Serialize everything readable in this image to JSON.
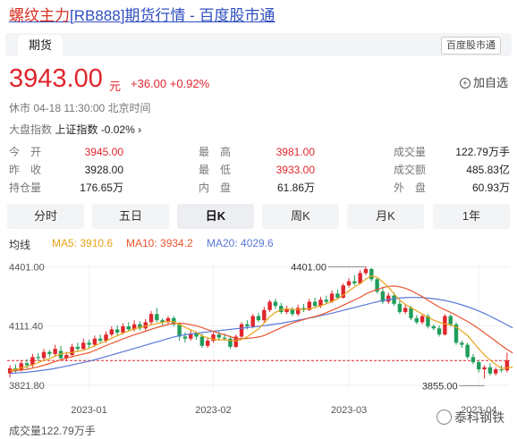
{
  "page": {
    "title_highlight": "螺纹主力",
    "title_rest": "[RB888]期货行情 - 百度股市通",
    "tab": "期货",
    "brand_button": "百度股市通"
  },
  "quote": {
    "price": "3943.00",
    "unit": "元",
    "change": "+36.00 +0.92%",
    "add_label": "加自选",
    "status": "休市  04-18 11:30:00  北京时间",
    "index_label": "大盘指数",
    "index_name": "上证指数",
    "index_change": "-0.02%"
  },
  "stats": {
    "open_label": "今　开",
    "open": "3945.00",
    "prev_label": "昨　收",
    "prev": "3928.00",
    "oi_label": "持仓量",
    "oi": "176.65万",
    "high_label": "最　高",
    "high": "3981.00",
    "low_label": "最　低",
    "low": "3933.00",
    "inner_label": "内　盘",
    "inner": "61.86万",
    "volume_label": "成交量",
    "volume": "122.79万手",
    "amount_label": "成交额",
    "amount": "485.83亿",
    "outer_label": "外　盘",
    "outer": "60.93万"
  },
  "periods": [
    "分时",
    "五日",
    "日K",
    "周K",
    "月K",
    "1年"
  ],
  "active_period": "日K",
  "ma": {
    "label": "均线",
    "ma5": "MA5: 3910.6",
    "ma10": "MA10: 3934.2",
    "ma20": "MA20: 4029.6"
  },
  "colors": {
    "up": "#e0262d",
    "down": "#1f9d5b",
    "ma5": "#e8a317",
    "ma10": "#e8552e",
    "ma20": "#5a78d8"
  },
  "chart_data": {
    "type": "candlestick",
    "y_ticks": [
      "4401.00",
      "4111.40",
      "3821.80"
    ],
    "ylim": [
      3800,
      4420
    ],
    "x_ticks": [
      "2023-01",
      "2023-02",
      "2023-03",
      "2023-04"
    ],
    "annotations": {
      "high": "4401.00",
      "low": "3855.00",
      "ref_price": 3943
    },
    "candles": [
      [
        3880,
        3905,
        3860,
        3920
      ],
      [
        3905,
        3895,
        3880,
        3925
      ],
      [
        3895,
        3930,
        3890,
        3945
      ],
      [
        3930,
        3920,
        3905,
        3950
      ],
      [
        3920,
        3960,
        3910,
        3975
      ],
      [
        3960,
        3955,
        3940,
        3980
      ],
      [
        3955,
        3985,
        3945,
        4000
      ],
      [
        3985,
        3975,
        3960,
        3995
      ],
      [
        3975,
        4000,
        3965,
        4020
      ],
      [
        3990,
        3955,
        3950,
        4015
      ],
      [
        3955,
        3970,
        3940,
        3985
      ],
      [
        3970,
        4010,
        3960,
        4025
      ],
      [
        4010,
        4000,
        3985,
        4030
      ],
      [
        4000,
        4030,
        3995,
        4050
      ],
      [
        4030,
        4020,
        4005,
        4045
      ],
      [
        4020,
        4050,
        4010,
        4065
      ],
      [
        4050,
        4040,
        4030,
        4070
      ],
      [
        4040,
        4070,
        4030,
        4085
      ],
      [
        4070,
        4095,
        4060,
        4110
      ],
      [
        4095,
        4080,
        4065,
        4115
      ],
      [
        4080,
        4110,
        4070,
        4125
      ],
      [
        4110,
        4095,
        4085,
        4130
      ],
      [
        4095,
        4120,
        4085,
        4140
      ],
      [
        4120,
        4100,
        4090,
        4135
      ],
      [
        4100,
        4130,
        4090,
        4145
      ],
      [
        4130,
        4170,
        4120,
        4185
      ],
      [
        4170,
        4140,
        4130,
        4200
      ],
      [
        4140,
        4130,
        4115,
        4150
      ],
      [
        4130,
        4150,
        4120,
        4160
      ],
      [
        4150,
        4120,
        4110,
        4160
      ],
      [
        4120,
        4060,
        4040,
        4130
      ],
      [
        4060,
        4050,
        4030,
        4080
      ],
      [
        4050,
        4075,
        4040,
        4090
      ],
      [
        4075,
        4060,
        4045,
        4085
      ],
      [
        4060,
        4015,
        4005,
        4075
      ],
      [
        4015,
        4040,
        4005,
        4055
      ],
      [
        4040,
        4070,
        4030,
        4080
      ],
      [
        4070,
        4055,
        4040,
        4085
      ],
      [
        4055,
        4050,
        4040,
        4075
      ],
      [
        4050,
        4010,
        4000,
        4065
      ],
      [
        4010,
        4060,
        4005,
        4070
      ],
      [
        4060,
        4120,
        4050,
        4130
      ],
      [
        4120,
        4110,
        4095,
        4140
      ],
      [
        4110,
        4160,
        4100,
        4170
      ],
      [
        4160,
        4140,
        4130,
        4175
      ],
      [
        4140,
        4190,
        4130,
        4205
      ],
      [
        4190,
        4230,
        4180,
        4240
      ],
      [
        4230,
        4210,
        4195,
        4245
      ],
      [
        4210,
        4180,
        4170,
        4225
      ],
      [
        4180,
        4195,
        4170,
        4210
      ],
      [
        4195,
        4170,
        4160,
        4205
      ],
      [
        4170,
        4200,
        4160,
        4215
      ],
      [
        4200,
        4190,
        4180,
        4220
      ],
      [
        4190,
        4230,
        4185,
        4245
      ],
      [
        4230,
        4210,
        4200,
        4250
      ],
      [
        4210,
        4240,
        4200,
        4255
      ],
      [
        4240,
        4230,
        4220,
        4260
      ],
      [
        4230,
        4270,
        4225,
        4285
      ],
      [
        4270,
        4250,
        4240,
        4290
      ],
      [
        4250,
        4310,
        4245,
        4320
      ],
      [
        4310,
        4330,
        4300,
        4345
      ],
      [
        4330,
        4320,
        4310,
        4360
      ],
      [
        4320,
        4370,
        4315,
        4385
      ],
      [
        4370,
        4390,
        4360,
        4401
      ],
      [
        4390,
        4340,
        4330,
        4395
      ],
      [
        4340,
        4280,
        4270,
        4350
      ],
      [
        4280,
        4230,
        4220,
        4300
      ],
      [
        4230,
        4260,
        4220,
        4275
      ],
      [
        4260,
        4220,
        4210,
        4275
      ],
      [
        4220,
        4180,
        4170,
        4235
      ],
      [
        4180,
        4200,
        4170,
        4215
      ],
      [
        4200,
        4150,
        4140,
        4210
      ],
      [
        4150,
        4130,
        4120,
        4165
      ],
      [
        4130,
        4160,
        4120,
        4170
      ],
      [
        4160,
        4110,
        4100,
        4170
      ],
      [
        4110,
        4100,
        4090,
        4120
      ],
      [
        4100,
        4070,
        4060,
        4115
      ],
      [
        4070,
        4160,
        4065,
        4170
      ],
      [
        4160,
        4120,
        4110,
        4170
      ],
      [
        4120,
        4030,
        4020,
        4130
      ],
      [
        4030,
        4020,
        4005,
        4040
      ],
      [
        4020,
        3960,
        3950,
        4030
      ],
      [
        3960,
        3935,
        3925,
        3975
      ],
      [
        3935,
        3900,
        3885,
        3945
      ],
      [
        3900,
        3910,
        3855,
        3920
      ],
      [
        3910,
        3880,
        3870,
        3930
      ],
      [
        3880,
        3900,
        3870,
        3910
      ],
      [
        3900,
        3895,
        3885,
        3920
      ],
      [
        3895,
        3943,
        3885,
        3981
      ]
    ],
    "ma5": [
      3895,
      3900,
      3907,
      3913,
      3922,
      3933,
      3943,
      3952,
      3964,
      3976,
      3980,
      3982,
      3988,
      3993,
      4003,
      4015,
      4027,
      4038,
      4052,
      4064,
      4077,
      4087,
      4097,
      4105,
      4111,
      4118,
      4124,
      4130,
      4134,
      4133,
      4118,
      4106,
      4093,
      4081,
      4063,
      4054,
      4047,
      4044,
      4045,
      4041,
      4039,
      4046,
      4059,
      4079,
      4097,
      4126,
      4157,
      4178,
      4191,
      4195,
      4193,
      4192,
      4193,
      4196,
      4202,
      4210,
      4220,
      4232,
      4245,
      4263,
      4283,
      4302,
      4319,
      4340,
      4357,
      4349,
      4328,
      4301,
      4269,
      4238,
      4217,
      4201,
      4186,
      4170,
      4156,
      4140,
      4130,
      4122,
      4118,
      4107,
      4087,
      4066,
      4033,
      4001,
      3970,
      3946,
      3924,
      3905,
      3907,
      3911
    ],
    "ma10": [
      3890,
      3893,
      3897,
      3900,
      3906,
      3912,
      3920,
      3929,
      3938,
      3947,
      3955,
      3962,
      3969,
      3975,
      3981,
      3992,
      4004,
      4016,
      4027,
      4037,
      4049,
      4059,
      4069,
      4077,
      4086,
      4096,
      4104,
      4112,
      4119,
      4125,
      4125,
      4123,
      4118,
      4113,
      4104,
      4094,
      4085,
      4077,
      4069,
      4060,
      4051,
      4049,
      4051,
      4054,
      4058,
      4065,
      4078,
      4090,
      4103,
      4115,
      4126,
      4135,
      4143,
      4151,
      4158,
      4166,
      4177,
      4188,
      4200,
      4213,
      4226,
      4239,
      4252,
      4268,
      4280,
      4290,
      4299,
      4305,
      4307,
      4303,
      4296,
      4285,
      4270,
      4255,
      4237,
      4220,
      4204,
      4191,
      4178,
      4164,
      4149,
      4134,
      4117,
      4098,
      4078,
      4058,
      4038,
      4017,
      3998,
      3980
    ],
    "ma20": [
      3880,
      3882,
      3884,
      3886,
      3889,
      3892,
      3896,
      3900,
      3905,
      3910,
      3916,
      3922,
      3928,
      3934,
      3940,
      3947,
      3954,
      3962,
      3970,
      3978,
      3986,
      3994,
      4002,
      4010,
      4018,
      4026,
      4034,
      4042,
      4050,
      4058,
      4064,
      4069,
      4073,
      4077,
      4080,
      4083,
      4086,
      4089,
      4092,
      4095,
      4098,
      4101,
      4104,
      4107,
      4110,
      4113,
      4117,
      4121,
      4125,
      4130,
      4135,
      4140,
      4145,
      4150,
      4156,
      4162,
      4168,
      4174,
      4181,
      4188,
      4195,
      4202,
      4209,
      4216,
      4223,
      4230,
      4236,
      4241,
      4245,
      4248,
      4250,
      4251,
      4251,
      4250,
      4248,
      4245,
      4241,
      4236,
      4230,
      4223,
      4215,
      4206,
      4196,
      4185,
      4173,
      4160,
      4146,
      4132,
      4117,
      4102
    ]
  },
  "footer": {
    "volume_text": "成交量122.79万手",
    "watermark": "泰科钢铁"
  }
}
